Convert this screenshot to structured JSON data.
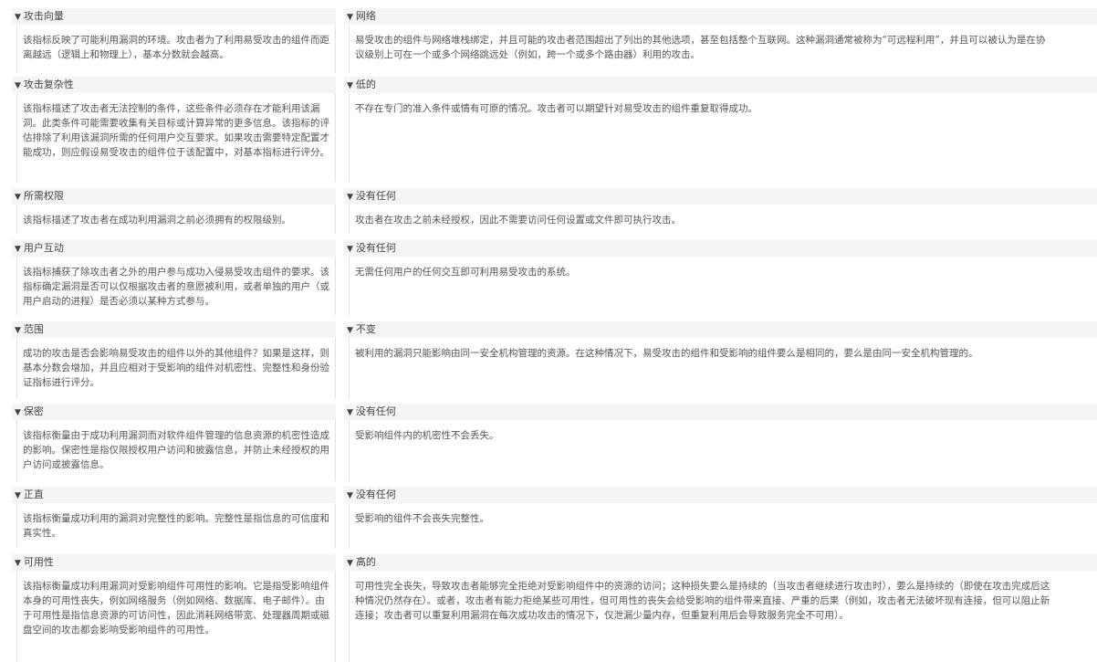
{
  "metrics": [
    {
      "name": "攻击向量",
      "name_desc": "该指标反映了可能利用漏洞的环境。攻击者为了利用易受攻击的组件而距离越远（逻辑上和物理上），基本分数就会越高。",
      "value": "网络",
      "value_desc": "易受攻击的组件与网络堆栈绑定，并且可能的攻击者范围超出了列出的其他选项，甚至包括整个互联网。这种漏洞通常被称为“可远程利用”，并且可以被认为是在协议级别上可在一个或多个网络跳远处（例如，跨一个或多个路由器）利用的攻击。"
    },
    {
      "name": "攻击复杂性",
      "name_desc": "该指标描述了攻击者无法控制的条件，这些条件必须存在才能利用该漏洞。此类条件可能需要收集有关目标或计算异常的更多信息。该指标的评估排除了利用该漏洞所需的任何用户交互要求。如果攻击需要特定配置才能成功，则应假设易受攻击的组件位于该配置中，对基本指标进行评分。",
      "value": "低的",
      "value_desc": "不存在专门的准入条件或情有可原的情况。攻击者可以期望针对易受攻击的组件重复取得成功。"
    },
    {
      "name": "所需权限",
      "name_desc": "该指标描述了攻击者在成功利用漏洞之前必须拥有的权限级别。",
      "value": "没有任何",
      "value_desc": "攻击者在攻击之前未经授权，因此不需要访问任何设置或文件即可执行攻击。"
    },
    {
      "name": "用户互动",
      "name_desc": "该指标捕获了除攻击者之外的用户参与成功入侵易受攻击组件的要求。该指标确定漏洞是否可以仅根据攻击者的意愿被利用，或者单独的用户（或用户启动的进程）是否必须以某种方式参与。",
      "value": "没有任何",
      "value_desc": "无需任何用户的任何交互即可利用易受攻击的系统。"
    },
    {
      "name": "范围",
      "name_desc": "成功的攻击是否会影响易受攻击的组件以外的其他组件？如果是这样，则基本分数会增加，并且应相对于受影响的组件对机密性、完整性和身份验证指标进行评分。",
      "value": "不变",
      "value_desc": "被利用的漏洞只能影响由同一安全机构管理的资源。在这种情况下，易受攻击的组件和受影响的组件要么是相同的，要么是由同一安全机构管理的。"
    },
    {
      "name": "保密",
      "name_desc": "该指标衡量由于成功利用漏洞而对软件组件管理的信息资源的机密性造成的影响。保密性是指仅限授权用户访问和披露信息，并防止未经授权的用户访问或披露信息。",
      "value": "没有任何",
      "value_desc": "受影响组件内的机密性不会丢失。"
    },
    {
      "name": "正直",
      "name_desc": "该指标衡量成功利用的漏洞对完整性的影响。完整性是指信息的可信度和真实性。",
      "value": "没有任何",
      "value_desc": "受影响的组件不会丧失完整性。"
    },
    {
      "name": "可用性",
      "name_desc": "该指标衡量成功利用漏洞对受影响组件可用性的影响。它是指受影响组件本身的可用性丧失，例如网络服务（例如网络、数据库、电子邮件）。由于可用性是指信息资源的可访问性，因此消耗网络带宽、处理器周期或磁盘空间的攻击都会影响受影响组件的可用性。",
      "value": "高的",
      "value_desc": "可用性完全丧失，导致攻击者能够完全拒绝对受影响组件中的资源的访问；这种损失要么是持续的（当攻击者继续进行攻击时），要么是持续的（即使在攻击完成后这种情况仍然存在）。或者，攻击者有能力拒绝某些可用性，但可用性的丧失会给受影响的组件带来直接、严重的后果（例如，攻击者无法破坏现有连接，但可以阻止新连接；攻击者可以重复利用漏洞在每次成功攻击的情况下，仅泄漏少量内存，但重复利用后会导致服务完全不可用）。"
    }
  ]
}
